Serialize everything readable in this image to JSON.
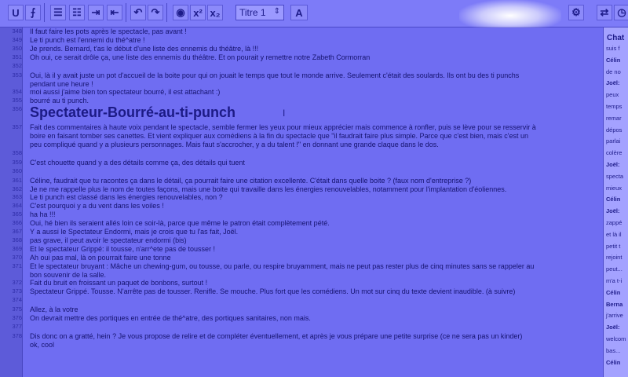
{
  "toolbar": {
    "underline": "U",
    "superscript": "x²",
    "subscript": "x₂",
    "style_select": "Titre 1",
    "style_arrow": "⇕",
    "font_button": "A"
  },
  "editor": {
    "heading": "Spectateur-Bourré-au-ti-punch",
    "lines": [
      {
        "n": "348",
        "t": "Il faut faire les pots après le spectacle, pas avant !"
      },
      {
        "n": "349",
        "t": "Le ti punch est l'ennemi du thé^atre !"
      },
      {
        "n": "350",
        "t": "Je prends. Bernard, t'as le début d'une liste des ennemis du théâtre, là !!!"
      },
      {
        "n": "351",
        "t": "Oh oui, ce serait drôle ça, une liste des ennemis du théâtre. Et on pourait y remettre notre Zabeth Cormorran"
      },
      {
        "n": "352",
        "t": ""
      },
      {
        "n": "353",
        "t": "Oui, là il y avait juste un pot d'accueil de la boite pour qui on jouait le temps que tout le monde arrive. Seulement c'était des soulards. Ils ont bu des ti punchs"
      },
      {
        "n": "",
        "t": "pendant une heure !"
      },
      {
        "n": "354",
        "t": "moi aussi j'aime bien ton spectateur bourré, il est attachant :)"
      },
      {
        "n": "355",
        "t": "bourré au ti punch."
      },
      {
        "n": "356",
        "t": ""
      },
      {
        "n": "357",
        "t": "Fait des commentaires à haute voix pendant le spectacle, semble fermer les yeux pour mieux apprécier mais commence à ronfler, puis se lève pour se resservir à"
      },
      {
        "n": "",
        "t": "boire en faisant tomber ses canettes. Et vient expliquer aux comédiens à la fin du spectacle que \"il faudrait faire plus simple. Parce que c'est bien, mais c'est un"
      },
      {
        "n": "",
        "t": "peu compliqué quand y a plusieurs personnages. Mais faut s'accrocher, y a du talent !\" en donnant une grande claque dans le dos."
      },
      {
        "n": "358",
        "t": ""
      },
      {
        "n": "359",
        "t": "C'est chouette quand y a des détails comme ça, des détails qui tuent"
      },
      {
        "n": "360",
        "t": ""
      },
      {
        "n": "361",
        "t": "Céline, faudrait que tu racontes ça dans le détail, ça pourrait faire une citation excellente. C'était dans quelle boite ? (faux nom d'entreprise ?)"
      },
      {
        "n": "362",
        "t": "Je ne me rappelle plus le nom de toutes façons, mais une boite qui travaille dans les énergies renouvelables, notamment pour l'implantation d'éoliennes."
      },
      {
        "n": "363",
        "t": "Le ti punch est classé dans les énergies renouvelables, non ?"
      },
      {
        "n": "364",
        "t": "C'est pourquoi y a du vent dans les voiles !"
      },
      {
        "n": "365",
        "t": "ha ha !!!"
      },
      {
        "n": "366",
        "t": "Oui, hé bien ils seraient allés loin ce soir-là, parce que même le patron était complètement pété."
      },
      {
        "n": "367",
        "t": "Y a aussi le Spectateur Endormi, mais je crois que tu l'as fait, Joël."
      },
      {
        "n": "368",
        "t": "pas grave, il peut avoir le spectateur endormi (bis)"
      },
      {
        "n": "369",
        "t": "Et le spectateur Grippé: il tousse, n'arr^ete pas de tousser !"
      },
      {
        "n": "370",
        "t": "Ah oui pas mal, là on pourrait faire une tonne"
      },
      {
        "n": "371",
        "t": "Et le spectateur bruyant : Mâche un chewing-gum, ou tousse, ou parle, ou respire bruyamment, mais ne peut pas rester plus de cinq minutes sans se rappeler au"
      },
      {
        "n": "",
        "t": "bon souvenir de la salle."
      },
      {
        "n": "372",
        "t": "Fait du bruit en froissant un paquet de bonbons, surtout !"
      },
      {
        "n": "373",
        "t": "Spectateur Grippé. Tousse. N'arrête pas de tousser. Renifle. Se mouche. Plus fort que les comédiens. Un mot sur cinq du texte devient inaudible. (à suivre)"
      },
      {
        "n": "374",
        "t": ""
      },
      {
        "n": "375",
        "t": "Allez, à la votre"
      },
      {
        "n": "376",
        "t": "On devrait mettre des portiques en entrée de thé^atre, des portiques sanitaires, non mais."
      },
      {
        "n": "377",
        "t": ""
      },
      {
        "n": "378",
        "t": "Dis donc on a gratté, hein ? Je vous propose de relire et de compléter éventuellement, et après je vous prépare une petite surprise (ce ne sera pas un kinder)"
      },
      {
        "n": "",
        "t": "ok, cool"
      }
    ]
  },
  "chat": {
    "title": "Chat",
    "messages": [
      {
        "t": "suis f"
      },
      {
        "t": "Célin"
      },
      {
        "t": "de no"
      },
      {
        "t": "Joël:"
      },
      {
        "t": "peux"
      },
      {
        "t": "temps"
      },
      {
        "t": "remar"
      },
      {
        "t": "dépos"
      },
      {
        "t": "parlai"
      },
      {
        "t": "colère"
      },
      {
        "t": "Joël:"
      },
      {
        "t": "specta"
      },
      {
        "t": "mieux"
      },
      {
        "t": "Célin"
      },
      {
        "t": "Joël:"
      },
      {
        "t": "zappé"
      },
      {
        "t": "et là il"
      },
      {
        "t": "petit t"
      },
      {
        "t": "rejoint"
      },
      {
        "t": "peut..."
      },
      {
        "t": "m'a t-i"
      },
      {
        "t": "Célin"
      },
      {
        "t": "Berna"
      },
      {
        "t": "j'arrive"
      },
      {
        "t": "Joël:"
      },
      {
        "t": "welcom"
      },
      {
        "t": "bas..."
      },
      {
        "t": "Célin"
      }
    ]
  }
}
